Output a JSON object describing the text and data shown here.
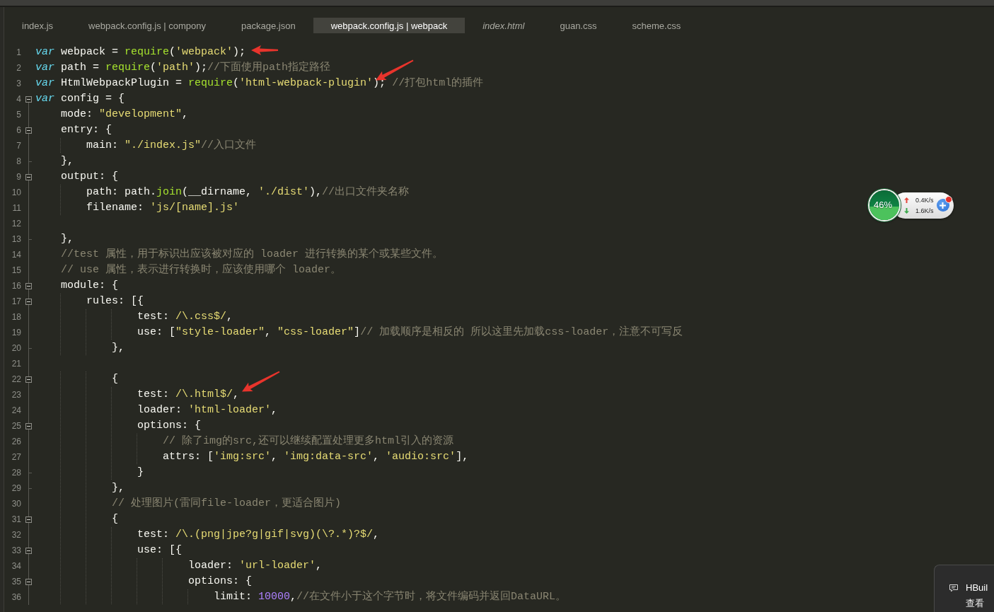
{
  "tabs": [
    {
      "label": "index.js",
      "selected": false,
      "preview": false
    },
    {
      "label": "webpack.config.js | compony",
      "selected": false,
      "preview": false
    },
    {
      "label": "package.json",
      "selected": false,
      "preview": false
    },
    {
      "label": "webpack.config.js | webpack",
      "selected": true,
      "preview": false
    },
    {
      "label": "index.html",
      "selected": false,
      "preview": true
    },
    {
      "label": "guan.css",
      "selected": false,
      "preview": false
    },
    {
      "label": "scheme.css",
      "selected": false,
      "preview": false
    }
  ],
  "editor": {
    "lines": [
      {
        "number": "1",
        "kind": "plain",
        "tokens": [
          {
            "kind": "keyword",
            "text": "var"
          },
          {
            "kind": "plain",
            "text": " webpack = "
          },
          {
            "kind": "function",
            "text": "require"
          },
          {
            "kind": "plain",
            "text": "("
          },
          {
            "kind": "string",
            "text": "'webpack'"
          },
          {
            "kind": "plain",
            "text": ");",
            "pointer": {
              "kind": "flat"
            }
          }
        ]
      },
      {
        "number": "2",
        "kind": "plain",
        "tokens": [
          {
            "kind": "keyword",
            "text": "var"
          },
          {
            "kind": "plain",
            "text": " path = "
          },
          {
            "kind": "function",
            "text": "require"
          },
          {
            "kind": "plain",
            "text": "("
          },
          {
            "kind": "string",
            "text": "'path'"
          },
          {
            "kind": "plain",
            "text": ");"
          },
          {
            "kind": "comment",
            "text": "//下面使用path指定路径"
          }
        ]
      },
      {
        "number": "3",
        "kind": "plain",
        "tokens": [
          {
            "kind": "keyword",
            "text": "var"
          },
          {
            "kind": "plain",
            "text": " HtmlWebpackPlugin = "
          },
          {
            "kind": "function",
            "text": "require"
          },
          {
            "kind": "plain",
            "text": "("
          },
          {
            "kind": "string",
            "text": "'html-webpack-plugin'",
            "pointer": {
              "kind": "slanted"
            }
          },
          {
            "kind": "plain",
            "text": "); "
          },
          {
            "kind": "comment",
            "text": "//打包html的插件"
          }
        ]
      },
      {
        "number": "4",
        "kind": "opener",
        "tokens": [
          {
            "kind": "keyword",
            "text": "var"
          },
          {
            "kind": "plain",
            "text": " config = {"
          }
        ]
      },
      {
        "number": "5",
        "kind": "inner",
        "tokens": [
          {
            "kind": "plain",
            "text": "    mode: "
          },
          {
            "kind": "string",
            "text": "\"development\""
          },
          {
            "kind": "plain",
            "text": ","
          }
        ]
      },
      {
        "number": "6",
        "kind": "opener",
        "tokens": [
          {
            "kind": "plain",
            "text": "    entry: {"
          }
        ]
      },
      {
        "number": "7",
        "kind": "inner",
        "tokens": [
          {
            "kind": "plain",
            "text": "        main: "
          },
          {
            "kind": "string",
            "text": "\"./index.js\""
          },
          {
            "kind": "comment",
            "text": "//入口文件"
          }
        ]
      },
      {
        "number": "8",
        "kind": "closer",
        "tokens": [
          {
            "kind": "plain",
            "text": "    },"
          }
        ]
      },
      {
        "number": "9",
        "kind": "opener",
        "tokens": [
          {
            "kind": "plain",
            "text": "    output: {"
          }
        ]
      },
      {
        "number": "10",
        "kind": "inner",
        "tokens": [
          {
            "kind": "plain",
            "text": "        path: path."
          },
          {
            "kind": "function",
            "text": "join"
          },
          {
            "kind": "plain",
            "text": "(__dirname, "
          },
          {
            "kind": "string",
            "text": "'./dist'"
          },
          {
            "kind": "plain",
            "text": "),"
          },
          {
            "kind": "comment",
            "text": "//出口文件夹名称"
          }
        ]
      },
      {
        "number": "11",
        "kind": "inner",
        "tokens": [
          {
            "kind": "plain",
            "text": "        filename: "
          },
          {
            "kind": "string",
            "text": "'js/[name].js'"
          }
        ]
      },
      {
        "number": "12",
        "kind": "inner"
      },
      {
        "number": "13",
        "kind": "closer",
        "tokens": [
          {
            "kind": "plain",
            "text": "    },"
          }
        ]
      },
      {
        "number": "14",
        "kind": "inner",
        "tokens": [
          {
            "kind": "comment",
            "text": "    //test 属性，用于标识出应该被对应的 loader 进行转换的某个或某些文件。"
          }
        ]
      },
      {
        "number": "15",
        "kind": "inner",
        "tokens": [
          {
            "kind": "comment",
            "text": "    // use 属性，表示进行转换时，应该使用哪个 loader。"
          }
        ]
      },
      {
        "number": "16",
        "kind": "opener",
        "tokens": [
          {
            "kind": "plain",
            "text": "    module: {"
          }
        ]
      },
      {
        "number": "17",
        "kind": "opener",
        "tokens": [
          {
            "kind": "plain",
            "text": "        rules: [{"
          }
        ]
      },
      {
        "number": "18",
        "kind": "inner",
        "tokens": [
          {
            "kind": "plain",
            "text": "                test: "
          },
          {
            "kind": "regex",
            "text": "/\\.css$/"
          },
          {
            "kind": "plain",
            "text": ","
          }
        ]
      },
      {
        "number": "19",
        "kind": "inner",
        "tokens": [
          {
            "kind": "plain",
            "text": "                use: ["
          },
          {
            "kind": "string",
            "text": "\"style-loader\""
          },
          {
            "kind": "plain",
            "text": ", "
          },
          {
            "kind": "string",
            "text": "\"css-loader\""
          },
          {
            "kind": "plain",
            "text": "]"
          },
          {
            "kind": "comment",
            "text": "// 加载顺序是相反的 所以这里先加载css-loader，注意不可写反"
          }
        ]
      },
      {
        "number": "20",
        "kind": "closer",
        "tokens": [
          {
            "kind": "plain",
            "text": "            },"
          }
        ]
      },
      {
        "number": "21",
        "kind": "inner"
      },
      {
        "number": "22",
        "kind": "opener",
        "tokens": [
          {
            "kind": "plain",
            "text": "            {"
          }
        ]
      },
      {
        "number": "23",
        "kind": "inner",
        "tokens": [
          {
            "kind": "plain",
            "text": "                test: "
          },
          {
            "kind": "regex",
            "text": "/\\.html$/"
          },
          {
            "kind": "plain",
            "text": ",",
            "pointer": {
              "kind": "slanted"
            }
          }
        ]
      },
      {
        "number": "24",
        "kind": "inner",
        "tokens": [
          {
            "kind": "plain",
            "text": "                loader: "
          },
          {
            "kind": "string",
            "text": "'html-loader'"
          },
          {
            "kind": "plain",
            "text": ","
          }
        ]
      },
      {
        "number": "25",
        "kind": "opener",
        "tokens": [
          {
            "kind": "plain",
            "text": "                options: {"
          }
        ]
      },
      {
        "number": "26",
        "kind": "inner",
        "tokens": [
          {
            "kind": "comment",
            "text": "                    // 除了img的src,还可以继续配置处理更多html引入的资源"
          }
        ]
      },
      {
        "number": "27",
        "kind": "inner",
        "tokens": [
          {
            "kind": "plain",
            "text": "                    attrs: ["
          },
          {
            "kind": "string",
            "text": "'img:src'"
          },
          {
            "kind": "plain",
            "text": ", "
          },
          {
            "kind": "string",
            "text": "'img:data-src'"
          },
          {
            "kind": "plain",
            "text": ", "
          },
          {
            "kind": "string",
            "text": "'audio:src'"
          },
          {
            "kind": "plain",
            "text": "],"
          }
        ]
      },
      {
        "number": "28",
        "kind": "closer",
        "tokens": [
          {
            "kind": "plain",
            "text": "                }"
          }
        ]
      },
      {
        "number": "29",
        "kind": "closer",
        "tokens": [
          {
            "kind": "plain",
            "text": "            },"
          }
        ]
      },
      {
        "number": "30",
        "kind": "inner",
        "tokens": [
          {
            "kind": "comment",
            "text": "            // 处理图片(雷同file-loader，更适合图片)"
          }
        ]
      },
      {
        "number": "31",
        "kind": "opener",
        "tokens": [
          {
            "kind": "plain",
            "text": "            {"
          }
        ]
      },
      {
        "number": "32",
        "kind": "inner",
        "tokens": [
          {
            "kind": "plain",
            "text": "                test: "
          },
          {
            "kind": "regex",
            "text": "/\\.(png|jpe?g|gif|svg)(\\?.*)?$/"
          },
          {
            "kind": "plain",
            "text": ","
          }
        ]
      },
      {
        "number": "33",
        "kind": "opener",
        "tokens": [
          {
            "kind": "plain",
            "text": "                use: [{"
          }
        ]
      },
      {
        "number": "34",
        "kind": "inner",
        "tokens": [
          {
            "kind": "plain",
            "text": "                        loader: "
          },
          {
            "kind": "string",
            "text": "'url-loader'"
          },
          {
            "kind": "plain",
            "text": ","
          }
        ]
      },
      {
        "number": "35",
        "kind": "opener",
        "tokens": [
          {
            "kind": "plain",
            "text": "                        options: {"
          }
        ]
      },
      {
        "number": "36",
        "kind": "inner",
        "tokens": [
          {
            "kind": "plain",
            "text": "                            limit: "
          },
          {
            "kind": "number",
            "text": "10000"
          },
          {
            "kind": "plain",
            "text": ","
          },
          {
            "kind": "comment",
            "text": "//在文件小于这个字节时，将文件编码并返回DataURL。"
          }
        ]
      }
    ]
  },
  "network_widget": {
    "usage": "46%",
    "level": 0.46,
    "upload_speed": "0.4K/s",
    "download_speed": "1.6K/s",
    "has_alert": true
  },
  "notification_popup": {
    "title": "HBuil",
    "text": "查看"
  }
}
